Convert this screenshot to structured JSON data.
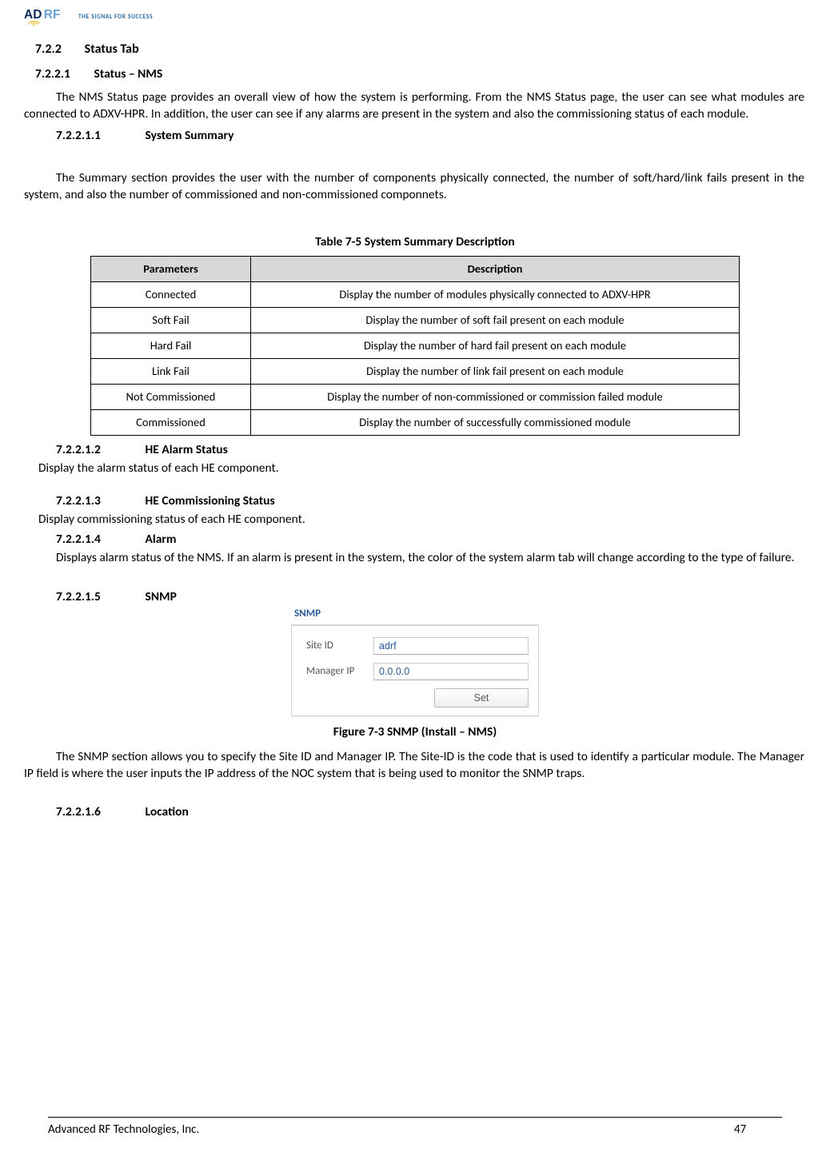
{
  "header": {
    "tagline": "THE SIGNAL FOR SUCCESS"
  },
  "headings": {
    "h722_num": "7.2.2",
    "h722_title": "Status Tab",
    "h7221_num": "7.2.2.1",
    "h7221_title": "Status – NMS",
    "h72211_num": "7.2.2.1.1",
    "h72211_title": "System Summary",
    "h72212_num": "7.2.2.1.2",
    "h72212_title": "HE Alarm Status",
    "h72213_num": "7.2.2.1.3",
    "h72213_title": "HE Commissioning Status",
    "h72214_num": "7.2.2.1.4",
    "h72214_title": "Alarm",
    "h72215_num": "7.2.2.1.5",
    "h72215_title": "SNMP",
    "h72216_num": "7.2.2.1.6",
    "h72216_title": "Location"
  },
  "paragraphs": {
    "p1": "The NMS Status page provides an overall view of how the system is performing.  From the NMS Status page, the user can see what modules are connected to ADXV-HPR.  In addition, the user can see if any alarms are present in the system and also the commissioning status of each module.",
    "p2": "The Summary section provides the user with the number of components physically connected, the number of soft/hard/link fails present in the system, and also the number of commissioned and non-commissioned componnets.",
    "p3": "Display the alarm status of each HE component.",
    "p4": "Display commissioning status of each HE component.",
    "p5": "Displays alarm status of the NMS. If an alarm is present in the system, the color of the system alarm tab will change according to the type of failure.",
    "p6": "The SNMP section allows you to specify the Site ID and Manager IP.  The Site-ID is the code that is used to identify a particular module.  The Manager IP field is where the user inputs the IP address of the NOC system that is being used to monitor the SNMP traps."
  },
  "table": {
    "caption": "Table 7-5       System Summary Description",
    "headers": {
      "c1": "Parameters",
      "c2": "Description"
    },
    "rows": [
      {
        "param": "Connected",
        "desc": "Display the number of modules physically connected to ADXV-HPR"
      },
      {
        "param": "Soft Fail",
        "desc": "Display the number of soft fail present on each module"
      },
      {
        "param": "Hard Fail",
        "desc": "Display the number of hard fail present on each module"
      },
      {
        "param": "Link Fail",
        "desc": "Display the number of link fail present on each module"
      },
      {
        "param": "Not Commissioned",
        "desc": "Display the number of non-commissioned or commission failed module"
      },
      {
        "param": "Commissioned",
        "desc": "Display the number of successfully commissioned module"
      }
    ]
  },
  "snmp": {
    "title": "SNMP",
    "site_id_label": "Site ID",
    "site_id_value": "adrf",
    "manager_ip_label": "Manager IP",
    "manager_ip_value": "0.0.0.0",
    "set_button": "Set"
  },
  "figure_caption": "Figure 7-3      SNMP (Install – NMS)",
  "footer": {
    "company": "Advanced RF Technologies, Inc.",
    "page": "47"
  }
}
